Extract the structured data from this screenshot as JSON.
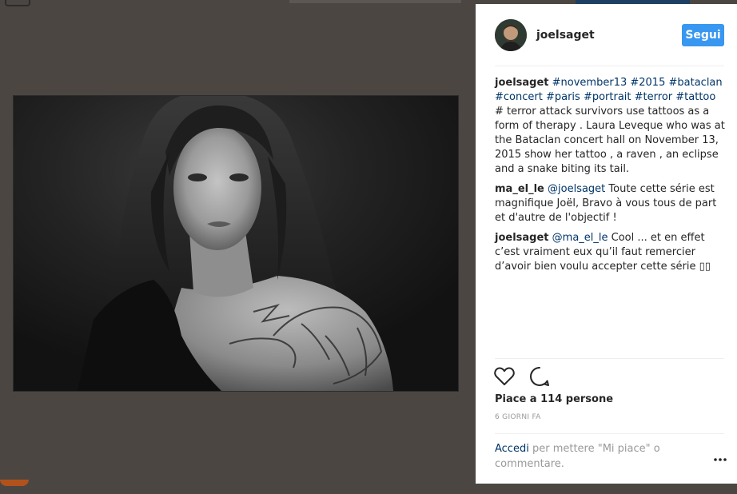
{
  "post": {
    "username": "joelsaget",
    "follow_label": "Segui"
  },
  "comments": [
    {
      "user": "joelsaget",
      "parts": [
        {
          "text": "#november13",
          "tag": true
        },
        {
          "text": " ",
          "tag": false
        },
        {
          "text": "#2015",
          "tag": true
        },
        {
          "text": " ",
          "tag": false
        },
        {
          "text": "#bataclan",
          "tag": true
        },
        {
          "text": " ",
          "tag": false
        },
        {
          "text": "#concert",
          "tag": true
        },
        {
          "text": " ",
          "tag": false
        },
        {
          "text": "#paris",
          "tag": true
        },
        {
          "text": " ",
          "tag": false
        },
        {
          "text": "#portrait",
          "tag": true
        },
        {
          "text": " ",
          "tag": false
        },
        {
          "text": "#terror",
          "tag": true
        },
        {
          "text": " ",
          "tag": false
        },
        {
          "text": "#tattoo",
          "tag": true
        },
        {
          "text": " ",
          "tag": false
        },
        {
          "text": "# terror attack survivors use tattoos as a form of therapy . Laura Leveque who was at the Bataclan concert hall on November 13, 2015 show her tattoo , a raven , an eclipse and a snake biting its tail.",
          "tag": false
        }
      ]
    },
    {
      "user": "ma_el_le",
      "parts": [
        {
          "text": "@joelsaget",
          "tag": true
        },
        {
          "text": " Toute cette série est magnifique Joël, Bravo à vous tous de part et d'autre de l'objectif !",
          "tag": false
        }
      ]
    },
    {
      "user": "joelsaget",
      "parts": [
        {
          "text": "@ma_el_le",
          "tag": true
        },
        {
          "text": " Cool ... et en effet c’est vraiment eux qu’il faut remercier d’avoir bien voulu accepter cette série ▯▯",
          "tag": false
        }
      ]
    }
  ],
  "likes": "Piace a 114 persone",
  "time_ago": "6 GIORNI FA",
  "login": {
    "link": "Accedi",
    "rest": " per mettere \"Mi piace\" o commentare."
  },
  "icons": {
    "like": "heart-icon",
    "comment": "comment-bubble-icon",
    "more": "more-options-icon"
  },
  "colors": {
    "follow_button": "#3897f0",
    "link": "#003569",
    "backdrop": "#4b4642"
  }
}
